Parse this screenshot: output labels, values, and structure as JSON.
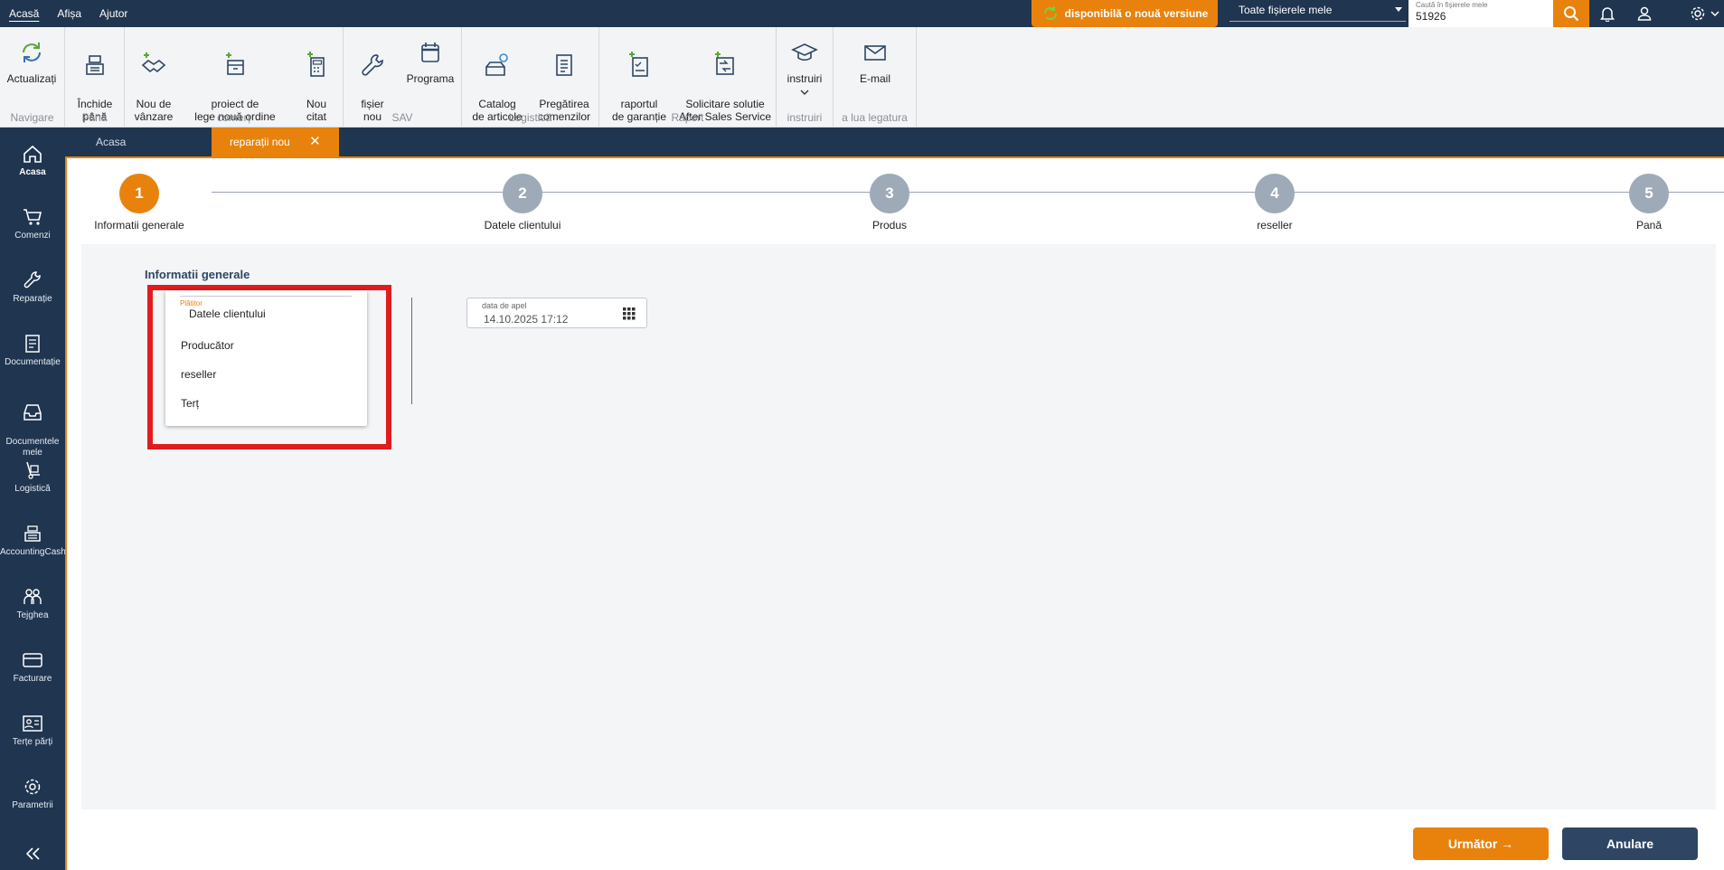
{
  "topbar": {
    "menu": [
      "Acasă",
      "Afișa",
      "Ajutor"
    ],
    "update_notice": "disponibilă o nouă versiune",
    "scope_select": "Toate fișierele mele",
    "search": {
      "label": "Caută în fișierele mele",
      "value": "51926"
    }
  },
  "ribbon": {
    "groups": [
      {
        "label": "Navigare",
        "buttons": [
          "Actualizați"
        ]
      },
      {
        "label": "Până",
        "buttons": [
          "Închide\npână"
        ]
      },
      {
        "label": "comerț",
        "buttons": [
          "Nou de\nvânzare",
          "proiect de\nlege nouă ordine",
          "Nou\ncitat"
        ]
      },
      {
        "label": "SAV",
        "buttons": [
          "fișier\nnou",
          "Programa"
        ]
      },
      {
        "label": "Logistică",
        "buttons": [
          "Catalog\nde articole",
          "Pregătirea\ncomenzilor"
        ]
      },
      {
        "label": "Raport",
        "buttons": [
          "raportul\nde garanție",
          "Solicitare solutie\nAfter Sales Service"
        ]
      },
      {
        "label": "instruiri",
        "buttons": [
          "instruiri"
        ]
      },
      {
        "label": "a lua legatura",
        "buttons": [
          "E-mail"
        ]
      }
    ]
  },
  "sidenav": [
    "Acasa",
    "Comenzi",
    "Reparație",
    "Documentație",
    "Documentele\nmele",
    "Logistică",
    "AccountingCash",
    "Tejghea",
    "Facturare",
    "Terțe părți",
    "Parametrii"
  ],
  "tabs": [
    "Acasa",
    "reparații nou"
  ],
  "stepper": [
    {
      "num": "1",
      "label": "Informatii generale"
    },
    {
      "num": "2",
      "label": "Datele clientului"
    },
    {
      "num": "3",
      "label": "Produs"
    },
    {
      "num": "4",
      "label": "reseller"
    },
    {
      "num": "5",
      "label": "Pană"
    }
  ],
  "form": {
    "section_title": "Informatii generale",
    "payer": {
      "label": "Plătitor",
      "selected": "Datele clientului",
      "options": [
        "Producător",
        "reseller",
        "Terț"
      ]
    },
    "call_date": {
      "label": "data de apel",
      "value": "14.10.2025 17:12"
    }
  },
  "buttons": {
    "next": "Următor →",
    "cancel": "Anulare"
  },
  "colors": {
    "accent": "#e8820c",
    "navy": "#1f3550",
    "highlight": "#e11c1c"
  }
}
